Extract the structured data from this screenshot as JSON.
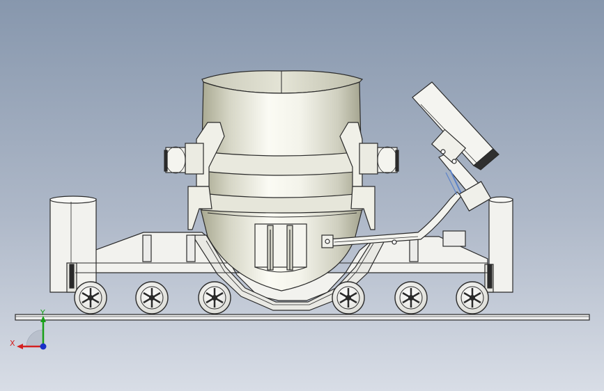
{
  "triad": {
    "x_label": "X",
    "y_label": "Y",
    "x_color": "#d42020",
    "y_color": "#18a018",
    "z_color": "#1830c8"
  },
  "colors": {
    "bg_top": "#8797ad",
    "bg_bottom": "#d4dae3",
    "steel": "#f2f2ee",
    "ladle_dark": "#a9a993",
    "ladle_light": "#f6f6ee",
    "line": "#2a2a2a",
    "hose": "#5b82c8"
  },
  "icons": {
    "wheel": "wheel-icon",
    "axis_triad": "axis-triad-icon"
  }
}
